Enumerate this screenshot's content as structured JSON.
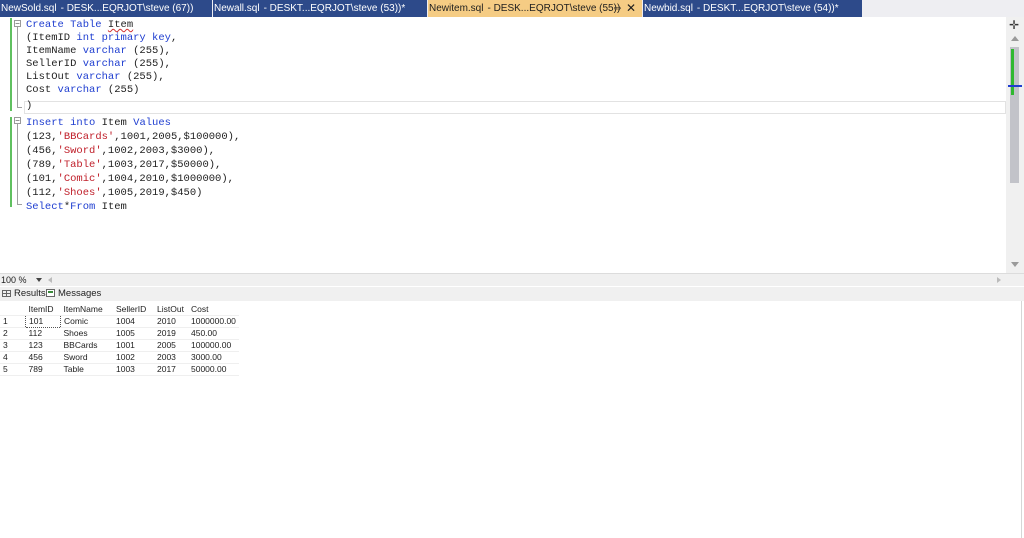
{
  "tabs": [
    {
      "name": "NewSold.sql",
      "desc": "- DESK...EQRJOT\\steve (67))",
      "active": false
    },
    {
      "name": "Newall.sql",
      "desc": "- DESKT...EQRJOT\\steve (53))*",
      "active": false
    },
    {
      "name": "Newitem.sql",
      "desc": "- DESK...EQRJOT\\steve (55))",
      "active": true,
      "pin_icon": "pin-icon",
      "close_icon": "close-icon"
    },
    {
      "name": "Newbid.sql",
      "desc": "- DESKT...EQRJOT\\steve (54))*",
      "active": false
    }
  ],
  "editor": {
    "lines": [
      [
        {
          "t": "Create Table ",
          "c": "kw"
        },
        {
          "t": "Item",
          "c": "id sq"
        }
      ],
      [
        {
          "t": "(ItemID ",
          "c": "id"
        },
        {
          "t": "int primary key",
          "c": "kw"
        },
        {
          "t": ",",
          "c": "id"
        }
      ],
      [
        {
          "t": "ItemName ",
          "c": "id"
        },
        {
          "t": "varchar",
          "c": "kw"
        },
        {
          "t": " (255),",
          "c": "id"
        }
      ],
      [
        {
          "t": "SellerID ",
          "c": "id"
        },
        {
          "t": "varchar",
          "c": "kw"
        },
        {
          "t": " (255),",
          "c": "id"
        }
      ],
      [
        {
          "t": "ListOut ",
          "c": "id"
        },
        {
          "t": "varchar",
          "c": "kw"
        },
        {
          "t": " (255),",
          "c": "id"
        }
      ],
      [
        {
          "t": "Cost ",
          "c": "id"
        },
        {
          "t": "varchar",
          "c": "kw"
        },
        {
          "t": " (255)",
          "c": "id"
        }
      ],
      [
        {
          "t": ")",
          "c": "id"
        }
      ],
      [
        {
          "t": "Insert into ",
          "c": "kw"
        },
        {
          "t": "Item ",
          "c": "id"
        },
        {
          "t": "Values",
          "c": "kw"
        }
      ],
      [
        {
          "t": "(123,",
          "c": "id"
        },
        {
          "t": "'BBCards'",
          "c": "str"
        },
        {
          "t": ",1001,2005,$100000),",
          "c": "id"
        }
      ],
      [
        {
          "t": "(456,",
          "c": "id"
        },
        {
          "t": "'Sword'",
          "c": "str"
        },
        {
          "t": ",1002,2003,$3000),",
          "c": "id"
        }
      ],
      [
        {
          "t": "(789,",
          "c": "id"
        },
        {
          "t": "'Table'",
          "c": "str"
        },
        {
          "t": ",1003,2017,$50000),",
          "c": "id"
        }
      ],
      [
        {
          "t": "(101,",
          "c": "id"
        },
        {
          "t": "'Comic'",
          "c": "str"
        },
        {
          "t": ",1004,2010,$1000000),",
          "c": "id"
        }
      ],
      [
        {
          "t": "(112,",
          "c": "id"
        },
        {
          "t": "'Shoes'",
          "c": "str"
        },
        {
          "t": ",1005,2019,$450)",
          "c": "id"
        }
      ],
      [
        {
          "t": "Select",
          "c": "kw"
        },
        {
          "t": "*",
          "c": "id"
        },
        {
          "t": "From ",
          "c": "kw"
        },
        {
          "t": "Item",
          "c": "id"
        }
      ]
    ]
  },
  "scrollbar": {
    "split_icon": "split-icon",
    "change_color": "#2fb830",
    "caret_color": "#1f3ed0"
  },
  "status": {
    "zoom": "100 %"
  },
  "results_tabs": {
    "results_label": "Results",
    "messages_label": "Messages",
    "results_icon": "grid-icon",
    "messages_icon": "messages-icon"
  },
  "results_grid": {
    "columns": [
      "ItemID",
      "ItemName",
      "SellerID",
      "ListOut",
      "Cost"
    ],
    "rows": [
      {
        "num": "1",
        "cells": [
          "101",
          "Comic",
          "1004",
          "2010",
          "1000000.00"
        ]
      },
      {
        "num": "2",
        "cells": [
          "112",
          "Shoes",
          "1005",
          "2019",
          "450.00"
        ]
      },
      {
        "num": "3",
        "cells": [
          "123",
          "BBCards",
          "1001",
          "2005",
          "100000.00"
        ]
      },
      {
        "num": "4",
        "cells": [
          "456",
          "Sword",
          "1002",
          "2003",
          "3000.00"
        ]
      },
      {
        "num": "5",
        "cells": [
          "789",
          "Table",
          "1003",
          "2017",
          "50000.00"
        ]
      }
    ]
  },
  "colors": {
    "tab_inactive": "#2d4a8a",
    "tab_active": "#f5cc84",
    "keyword": "#1f3ed0",
    "string": "#c0202b"
  }
}
